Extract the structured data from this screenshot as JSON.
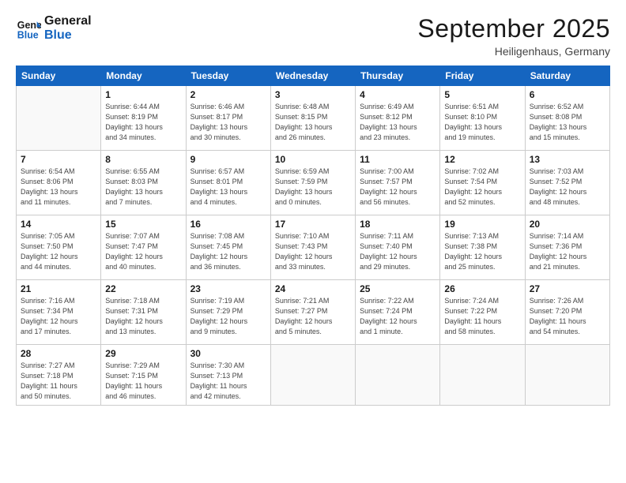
{
  "logo": {
    "line1": "General",
    "line2": "Blue"
  },
  "title": "September 2025",
  "subtitle": "Heiligenhaus, Germany",
  "weekdays": [
    "Sunday",
    "Monday",
    "Tuesday",
    "Wednesday",
    "Thursday",
    "Friday",
    "Saturday"
  ],
  "weeks": [
    [
      {
        "day": "",
        "info": ""
      },
      {
        "day": "1",
        "info": "Sunrise: 6:44 AM\nSunset: 8:19 PM\nDaylight: 13 hours\nand 34 minutes."
      },
      {
        "day": "2",
        "info": "Sunrise: 6:46 AM\nSunset: 8:17 PM\nDaylight: 13 hours\nand 30 minutes."
      },
      {
        "day": "3",
        "info": "Sunrise: 6:48 AM\nSunset: 8:15 PM\nDaylight: 13 hours\nand 26 minutes."
      },
      {
        "day": "4",
        "info": "Sunrise: 6:49 AM\nSunset: 8:12 PM\nDaylight: 13 hours\nand 23 minutes."
      },
      {
        "day": "5",
        "info": "Sunrise: 6:51 AM\nSunset: 8:10 PM\nDaylight: 13 hours\nand 19 minutes."
      },
      {
        "day": "6",
        "info": "Sunrise: 6:52 AM\nSunset: 8:08 PM\nDaylight: 13 hours\nand 15 minutes."
      }
    ],
    [
      {
        "day": "7",
        "info": "Sunrise: 6:54 AM\nSunset: 8:06 PM\nDaylight: 13 hours\nand 11 minutes."
      },
      {
        "day": "8",
        "info": "Sunrise: 6:55 AM\nSunset: 8:03 PM\nDaylight: 13 hours\nand 7 minutes."
      },
      {
        "day": "9",
        "info": "Sunrise: 6:57 AM\nSunset: 8:01 PM\nDaylight: 13 hours\nand 4 minutes."
      },
      {
        "day": "10",
        "info": "Sunrise: 6:59 AM\nSunset: 7:59 PM\nDaylight: 13 hours\nand 0 minutes."
      },
      {
        "day": "11",
        "info": "Sunrise: 7:00 AM\nSunset: 7:57 PM\nDaylight: 12 hours\nand 56 minutes."
      },
      {
        "day": "12",
        "info": "Sunrise: 7:02 AM\nSunset: 7:54 PM\nDaylight: 12 hours\nand 52 minutes."
      },
      {
        "day": "13",
        "info": "Sunrise: 7:03 AM\nSunset: 7:52 PM\nDaylight: 12 hours\nand 48 minutes."
      }
    ],
    [
      {
        "day": "14",
        "info": "Sunrise: 7:05 AM\nSunset: 7:50 PM\nDaylight: 12 hours\nand 44 minutes."
      },
      {
        "day": "15",
        "info": "Sunrise: 7:07 AM\nSunset: 7:47 PM\nDaylight: 12 hours\nand 40 minutes."
      },
      {
        "day": "16",
        "info": "Sunrise: 7:08 AM\nSunset: 7:45 PM\nDaylight: 12 hours\nand 36 minutes."
      },
      {
        "day": "17",
        "info": "Sunrise: 7:10 AM\nSunset: 7:43 PM\nDaylight: 12 hours\nand 33 minutes."
      },
      {
        "day": "18",
        "info": "Sunrise: 7:11 AM\nSunset: 7:40 PM\nDaylight: 12 hours\nand 29 minutes."
      },
      {
        "day": "19",
        "info": "Sunrise: 7:13 AM\nSunset: 7:38 PM\nDaylight: 12 hours\nand 25 minutes."
      },
      {
        "day": "20",
        "info": "Sunrise: 7:14 AM\nSunset: 7:36 PM\nDaylight: 12 hours\nand 21 minutes."
      }
    ],
    [
      {
        "day": "21",
        "info": "Sunrise: 7:16 AM\nSunset: 7:34 PM\nDaylight: 12 hours\nand 17 minutes."
      },
      {
        "day": "22",
        "info": "Sunrise: 7:18 AM\nSunset: 7:31 PM\nDaylight: 12 hours\nand 13 minutes."
      },
      {
        "day": "23",
        "info": "Sunrise: 7:19 AM\nSunset: 7:29 PM\nDaylight: 12 hours\nand 9 minutes."
      },
      {
        "day": "24",
        "info": "Sunrise: 7:21 AM\nSunset: 7:27 PM\nDaylight: 12 hours\nand 5 minutes."
      },
      {
        "day": "25",
        "info": "Sunrise: 7:22 AM\nSunset: 7:24 PM\nDaylight: 12 hours\nand 1 minute."
      },
      {
        "day": "26",
        "info": "Sunrise: 7:24 AM\nSunset: 7:22 PM\nDaylight: 11 hours\nand 58 minutes."
      },
      {
        "day": "27",
        "info": "Sunrise: 7:26 AM\nSunset: 7:20 PM\nDaylight: 11 hours\nand 54 minutes."
      }
    ],
    [
      {
        "day": "28",
        "info": "Sunrise: 7:27 AM\nSunset: 7:18 PM\nDaylight: 11 hours\nand 50 minutes."
      },
      {
        "day": "29",
        "info": "Sunrise: 7:29 AM\nSunset: 7:15 PM\nDaylight: 11 hours\nand 46 minutes."
      },
      {
        "day": "30",
        "info": "Sunrise: 7:30 AM\nSunset: 7:13 PM\nDaylight: 11 hours\nand 42 minutes."
      },
      {
        "day": "",
        "info": ""
      },
      {
        "day": "",
        "info": ""
      },
      {
        "day": "",
        "info": ""
      },
      {
        "day": "",
        "info": ""
      }
    ]
  ]
}
